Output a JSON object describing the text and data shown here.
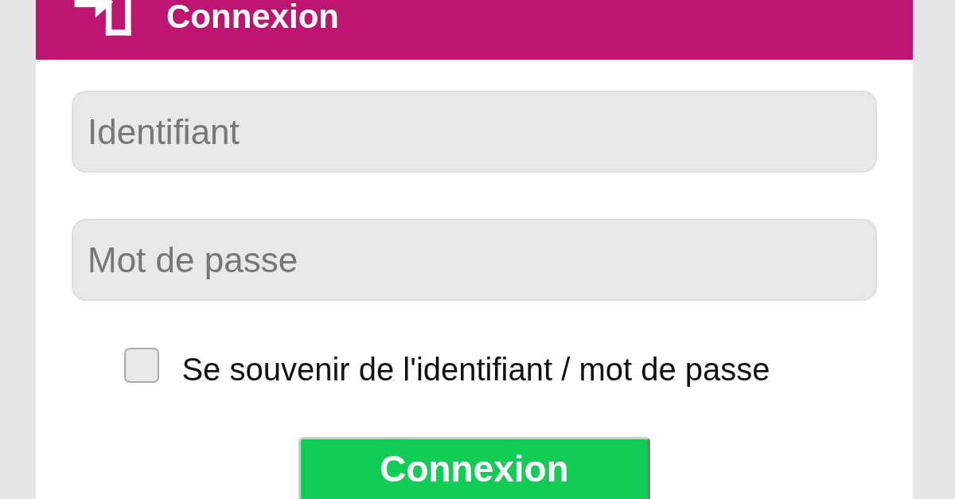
{
  "header": {
    "title": "Connexion"
  },
  "fields": [
    {
      "placeholder": "Identifiant"
    },
    {
      "placeholder": "Mot de passe"
    }
  ],
  "remember": {
    "label": "Se souvenir de l'identifiant / mot de passe",
    "checked": false
  },
  "submit": {
    "label": "Connexion"
  }
}
